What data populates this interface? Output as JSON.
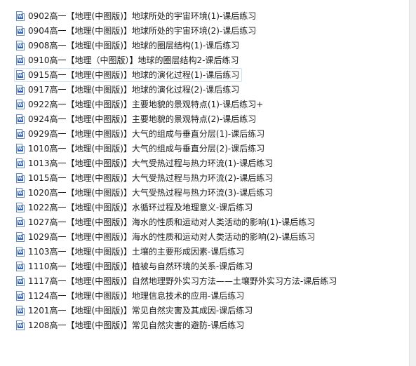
{
  "files": [
    {
      "name": "0902高一【地理(中图版)】地球所处的宇宙环境(1)-课后练习",
      "icon": "word-document-icon"
    },
    {
      "name": "0904高一【地理(中图版)】地球所处的宇宙环境(2)-课后练习",
      "icon": "word-document-icon"
    },
    {
      "name": "0908高一【地理(中图版)】地球的圈层结构(1)-课后练习",
      "icon": "word-document-icon"
    },
    {
      "name": "0910高一【地理（中图版）】地球的圈层结构2-课后练习",
      "icon": "word-document-icon"
    },
    {
      "name": "0915高一【地理(中图版)】地球的演化过程(1)-课后练习",
      "icon": "word-document-icon",
      "hovered": true
    },
    {
      "name": "0917高一【地理(中图版)】地球的演化过程(2)-课后练习",
      "icon": "word-document-icon"
    },
    {
      "name": "0922高一【地理(中图版)】主要地貌的景观特点(1)-课后练习+",
      "icon": "word-document-icon"
    },
    {
      "name": "0924高一【地理(中图版)】主要地貌的景观特点(2)-课后练习",
      "icon": "word-document-icon"
    },
    {
      "name": "0929高一【地理(中图版)】大气的组成与垂直分层(1)-课后练习",
      "icon": "word-document-icon"
    },
    {
      "name": "1010高一【地理(中图版)】大气的组成与垂直分层(2)-课后练习",
      "icon": "word-document-icon"
    },
    {
      "name": "1013高一【地理(中图版)】大气受热过程与热力环流(1)-课后练习",
      "icon": "word-document-icon"
    },
    {
      "name": "1015高一【地理(中图版)】大气受热过程与热力环流(2)-课后练习",
      "icon": "word-document-icon"
    },
    {
      "name": "1020高一【地理(中图版)】大气受热过程与热力环流(3)-课后练习",
      "icon": "word-document-icon"
    },
    {
      "name": "1022高一【地理(中图版)】水循环过程及地理意义-课后练习",
      "icon": "word-document-icon"
    },
    {
      "name": "1027高一【地理(中图版)】海水的性质和运动对人类活动的影响(1)-课后练习",
      "icon": "word-document-icon"
    },
    {
      "name": "1029高一【地理(中图版)】海水的性质和运动对人类活动的影响(2)-课后练习",
      "icon": "word-document-icon"
    },
    {
      "name": "1103高一【地理(中图版)】土壤的主要形成因素-课后练习",
      "icon": "word-document-icon"
    },
    {
      "name": "1110高一【地理(中图版)】植被与自然环境的关系-课后练习",
      "icon": "word-document-icon"
    },
    {
      "name": "1117高一【地理(中图版)】自然地理野外实习方法——土壤野外实习方法-课后练习",
      "icon": "word-document-icon"
    },
    {
      "name": "1124高一【地理(中图版)】地理信息技术的应用-课后练习",
      "icon": "word-document-icon"
    },
    {
      "name": "1201高一【地理(中图版)】常见自然灾害及其成因-课后练习",
      "icon": "word-document-icon"
    },
    {
      "name": "1208高一【地理(中图版)】常见自然灾害的避防-课后练习",
      "icon": "word-document-icon"
    }
  ]
}
